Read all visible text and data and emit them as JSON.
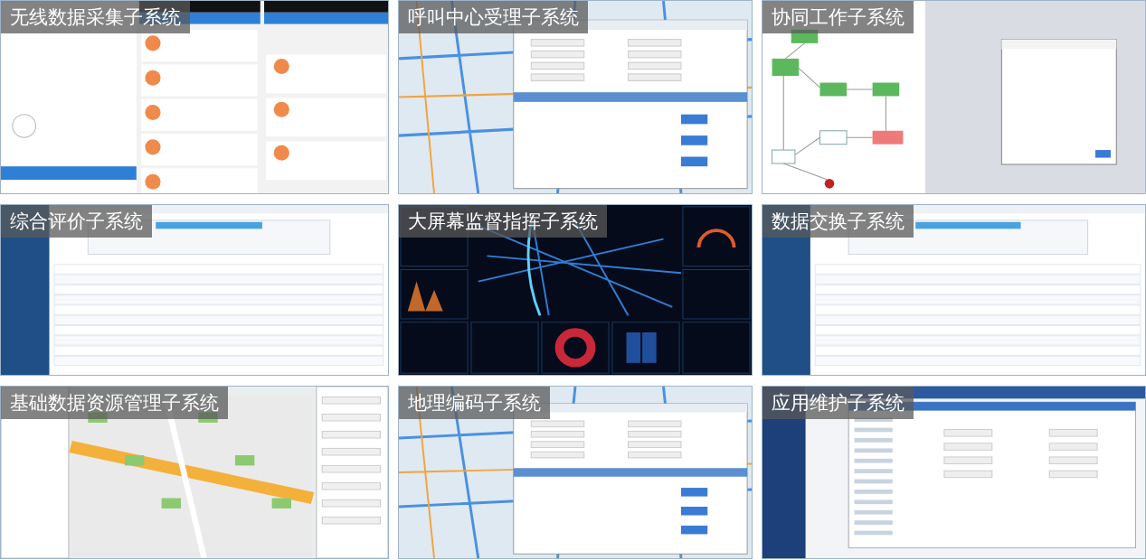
{
  "tiles": [
    {
      "title": "无线数据采集子系统",
      "kind": "mobile"
    },
    {
      "title": "呼叫中心受理子系统",
      "kind": "map-dialog"
    },
    {
      "title": "协同工作子系统",
      "kind": "flowchart"
    },
    {
      "title": "综合评价子系统",
      "kind": "table"
    },
    {
      "title": "大屏幕监督指挥子系统",
      "kind": "dashboard"
    },
    {
      "title": "数据交换子系统",
      "kind": "table"
    },
    {
      "title": "基础数据资源管理子系统",
      "kind": "gis"
    },
    {
      "title": "地理编码子系统",
      "kind": "map-dialog"
    },
    {
      "title": "应用维护子系统",
      "kind": "tree-form"
    }
  ]
}
